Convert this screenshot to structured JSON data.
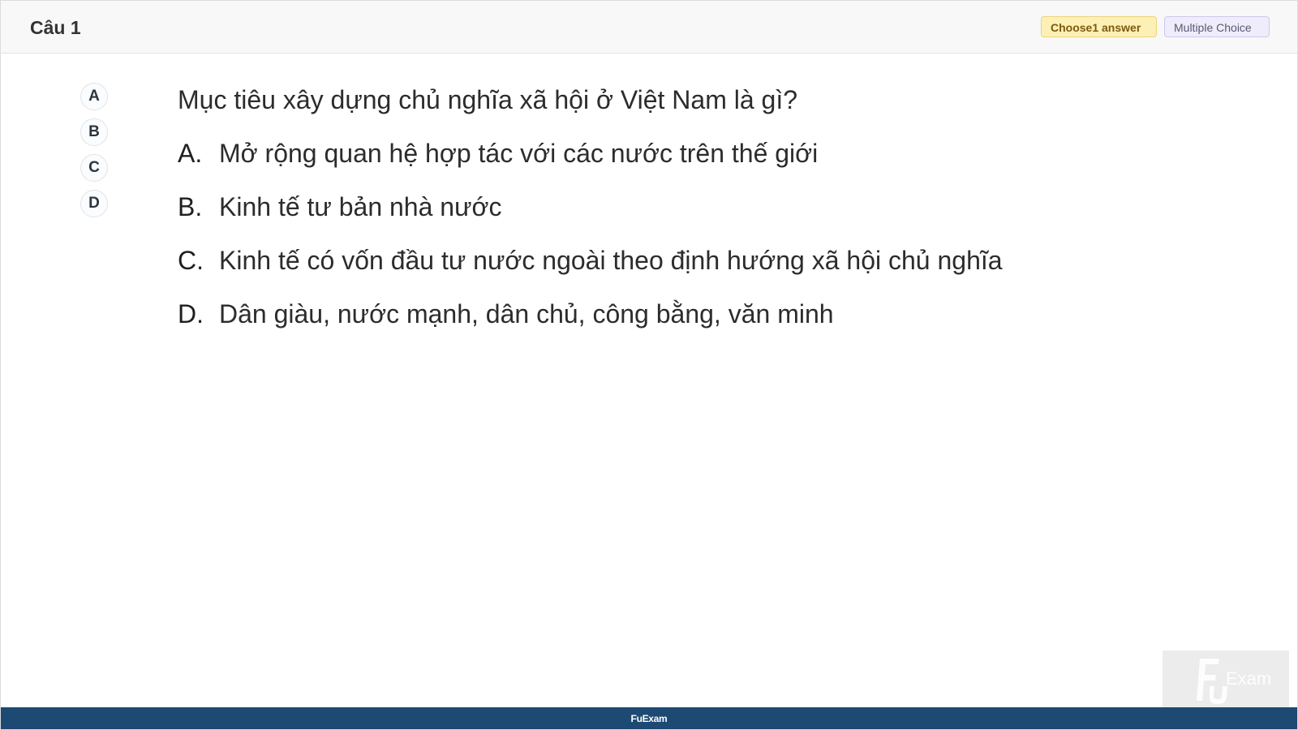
{
  "header": {
    "question_number": "Câu 1",
    "choose_badge": "Choose1 answer",
    "type_badge": "Multiple Choice"
  },
  "option_buttons": [
    "A",
    "B",
    "C",
    "D"
  ],
  "question": {
    "text": "Mục tiêu xây dựng chủ nghĩa xã hội ở Việt Nam là gì?",
    "answers": [
      {
        "letter": "A.",
        "text": "Mở rộng quan hệ hợp tác với các nước trên thế giới"
      },
      {
        "letter": "B.",
        "text": "Kinh tế tư bản nhà nước"
      },
      {
        "letter": "C.",
        "text": "Kinh tế có vốn đầu tư nước ngoài theo định hướng xã hội chủ nghĩa"
      },
      {
        "letter": "D.",
        "text": "Dân giàu, nước mạnh, dân chủ, công bằng, văn minh"
      }
    ]
  },
  "footer": {
    "brand": "FuExam"
  },
  "watermark": {
    "logo_text": "Exam",
    "icon": "fu-exam-logo-icon"
  },
  "colors": {
    "footer_bg": "#1d4a72",
    "choose_badge_bg": "#fdf0b5",
    "type_badge_bg": "#efecfb"
  }
}
